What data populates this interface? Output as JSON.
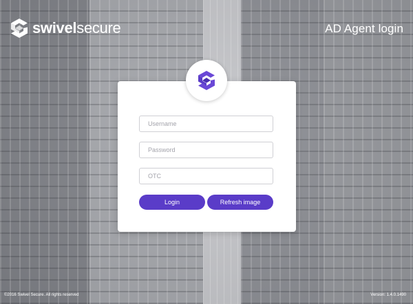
{
  "header": {
    "logo": {
      "brand_bold": "swivel",
      "brand_light": "secure",
      "icon": "swivel-logo-icon"
    },
    "page_title": "AD Agent login"
  },
  "login": {
    "badge_icon": "swivel-logo-icon",
    "username": {
      "value": "",
      "placeholder": "Username"
    },
    "password": {
      "value": "",
      "placeholder": "Password"
    },
    "otc": {
      "value": "",
      "placeholder": "OTC"
    },
    "login_label": "Login",
    "refresh_label": "Refresh image"
  },
  "footer": {
    "copyright": "©2016 Swivel Secure. All rights reserved",
    "version": "Version: 1.4.0.1490"
  },
  "colors": {
    "accent": "#5a3cc8",
    "card": "#ffffff",
    "background": "#9a9ca1"
  }
}
